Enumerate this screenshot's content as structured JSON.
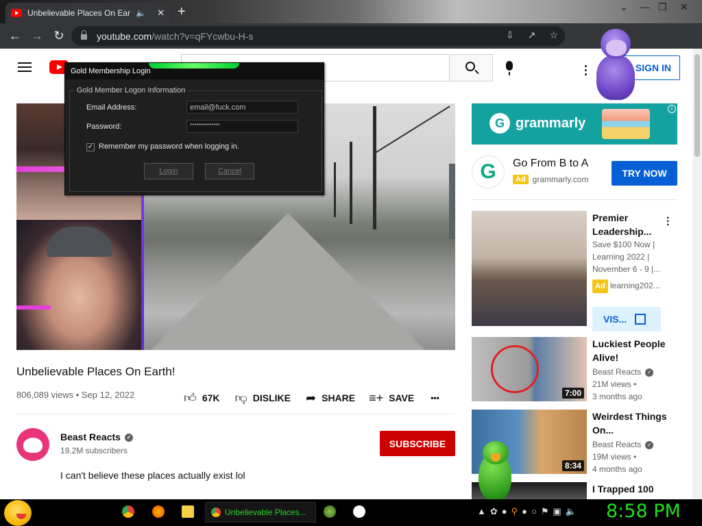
{
  "browser": {
    "tab_title": "Unbelievable Places On Earth!",
    "url_host": "youtube.com",
    "url_path": "/watch?v=qFYcwbu-H-s"
  },
  "header": {
    "sign_in": "SIGN IN"
  },
  "dialog": {
    "title": "Gold Membership Login",
    "group_label": "Gold Member Logon Information",
    "email_label": "Email Address:",
    "email_value": "email@fuck.com",
    "password_label": "Password:",
    "password_value": "**************",
    "remember_label": "Remember my password when logging in.",
    "remember_checked": "✓",
    "login_button": "Login",
    "cancel_button": "Cancel"
  },
  "video": {
    "title": "Unbelievable Places On Earth!",
    "meta": "806,089 views • Sep 12, 2022",
    "likes": "67K",
    "dislike": "DISLIKE",
    "share": "SHARE",
    "save": "SAVE",
    "more": "•••"
  },
  "channel": {
    "name": "Beast Reacts",
    "subscribers": "19.2M subscribers",
    "subscribe": "SUBSCRIBE",
    "description": "I can't believe these places actually exist lol"
  },
  "ad": {
    "banner_brand": "grammarly",
    "banner_logo": "G",
    "headline": "Go From B to A",
    "badge": "Ad",
    "domain": "grammarly.com",
    "cta": "TRY NOW",
    "info": "i"
  },
  "related": [
    {
      "title": "Premier Leadership...",
      "line1": "Save $100 Now |",
      "line2": "Learning 2022 |",
      "line3": "November 6 - 9 |...",
      "badge": "Ad",
      "domain": "learning202...",
      "cta": "VIS..."
    },
    {
      "title": "Luckiest People Alive!",
      "channel": "Beast Reacts",
      "views": "21M views •",
      "age": "3 months ago",
      "duration": "7:00"
    },
    {
      "title": "Weirdest Things On...",
      "channel": "Beast Reacts",
      "views": "19M views •",
      "age": "4 months ago",
      "duration": "8:34"
    },
    {
      "title": "I Trapped 100"
    }
  ],
  "taskbar": {
    "task_label": "Unbelievable Places...",
    "clock": "8:58 PM"
  },
  "colors": {
    "youtube_red": "#ff0000",
    "subscribe_red": "#cc0000",
    "link_blue": "#065fd4",
    "grammarly_teal": "#14a2a0",
    "clock_green": "#1ee01e"
  }
}
